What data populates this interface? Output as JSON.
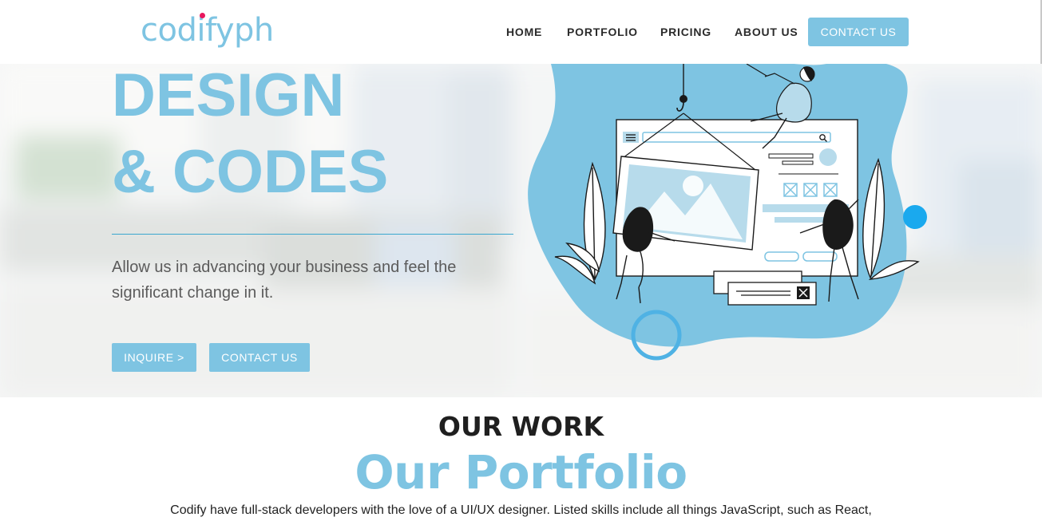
{
  "brand": {
    "name": "codifyph"
  },
  "nav": {
    "links": [
      "HOME",
      "PORTFOLIO",
      "PRICING",
      "ABOUT US"
    ],
    "cta": "CONTACT US"
  },
  "hero": {
    "title_line1": "DESIGN",
    "title_line2": "& CODES",
    "subtitle": "Allow us in advancing your business and feel the significant change in it.",
    "buttons": {
      "inquire": "INQUIRE >",
      "contact": "CONTACT US"
    }
  },
  "portfolio": {
    "eyebrow": "OUR WORK",
    "title": "Our Portfolio",
    "description": "Codify have full-stack developers with the love of a UI/UX designer. Listed skills include all things JavaScript, such as React,"
  },
  "colors": {
    "accent": "#7ec4e2",
    "accent_dark": "#3aa7cf",
    "brand_dot": "#e8175d",
    "bright_blue": "#1aa9ee",
    "text_dark": "#1f1f1f"
  },
  "icons": {
    "search": "search-icon",
    "hamburger": "hamburger-icon",
    "close": "close-x-icon"
  }
}
